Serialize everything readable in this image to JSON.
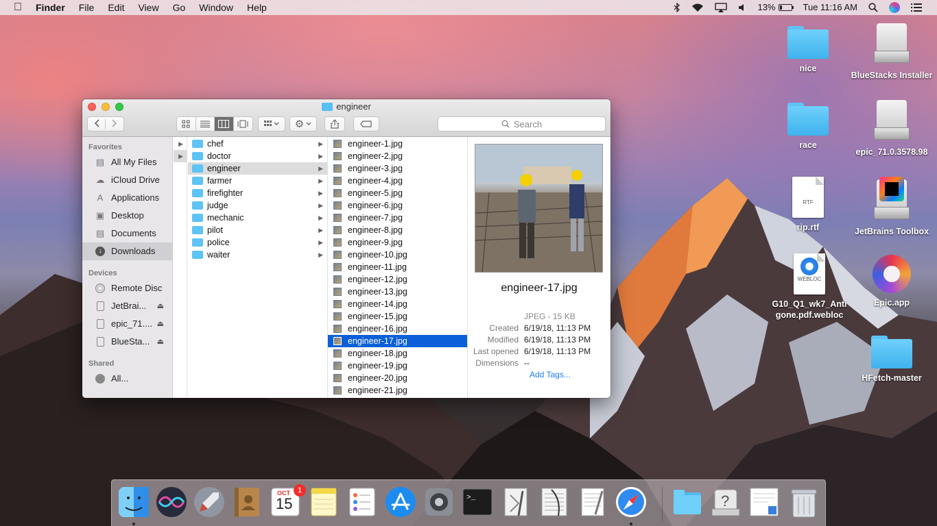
{
  "menubar": {
    "apple": "",
    "app_name": "Finder",
    "menus": [
      "File",
      "Edit",
      "View",
      "Go",
      "Window",
      "Help"
    ],
    "battery": "13%",
    "clock": "Tue 11:16 AM"
  },
  "desktop": {
    "icons": [
      {
        "label": "nice",
        "kind": "folder"
      },
      {
        "label": "BlueStacks Installer",
        "kind": "drive"
      },
      {
        "label": "race",
        "kind": "folder"
      },
      {
        "label": "epic_71.0.3578.98",
        "kind": "drive"
      },
      {
        "label": "rip.rtf",
        "kind": "document",
        "doc_label": "RTF"
      },
      {
        "label": "JetBrains Toolbox",
        "kind": "drive"
      },
      {
        "label": "G10_Q1_wk7_Antigone.pdf.webloc",
        "kind": "document",
        "doc_label": "WEBLOC"
      },
      {
        "label": "Epic.app",
        "kind": "app"
      },
      {
        "label": "HFetch-master",
        "kind": "folder"
      }
    ]
  },
  "finder": {
    "title": "engineer",
    "search_placeholder": "Search",
    "sidebar": {
      "favorites_header": "Favorites",
      "favorites": [
        {
          "label": "All My Files",
          "icon": "all-files-icon"
        },
        {
          "label": "iCloud Drive",
          "icon": "cloud-icon"
        },
        {
          "label": "Applications",
          "icon": "applications-icon"
        },
        {
          "label": "Desktop",
          "icon": "desktop-icon"
        },
        {
          "label": "Documents",
          "icon": "documents-icon"
        },
        {
          "label": "Downloads",
          "icon": "downloads-icon",
          "selected": true
        }
      ],
      "devices_header": "Devices",
      "devices": [
        {
          "label": "Remote Disc",
          "eject": false
        },
        {
          "label": "JetBrai...",
          "eject": true
        },
        {
          "label": "epic_71....",
          "eject": true
        },
        {
          "label": "BlueSta...",
          "eject": true
        }
      ],
      "shared_header": "Shared",
      "shared": [
        {
          "label": "All..."
        }
      ]
    },
    "folders": [
      "chef",
      "doctor",
      "engineer",
      "farmer",
      "firefighter",
      "judge",
      "mechanic",
      "pilot",
      "police",
      "waiter"
    ],
    "selected_folder": "engineer",
    "files": [
      "engineer-1.jpg",
      "engineer-2.jpg",
      "engineer-3.jpg",
      "engineer-4.jpg",
      "engineer-5.jpg",
      "engineer-6.jpg",
      "engineer-7.jpg",
      "engineer-8.jpg",
      "engineer-9.jpg",
      "engineer-10.jpg",
      "engineer-11.jpg",
      "engineer-12.jpg",
      "engineer-13.jpg",
      "engineer-14.jpg",
      "engineer-15.jpg",
      "engineer-16.jpg",
      "engineer-17.jpg",
      "engineer-18.jpg",
      "engineer-19.jpg",
      "engineer-20.jpg",
      "engineer-21.jpg"
    ],
    "selected_file": "engineer-17.jpg",
    "preview": {
      "name": "engineer-17.jpg",
      "kind_size": "JPEG - 15 KB",
      "created_label": "Created",
      "created": "6/19/18, 11:13 PM",
      "modified_label": "Modified",
      "modified": "6/19/18, 11:13 PM",
      "last_opened_label": "Last opened",
      "last_opened": "6/19/18, 11:13 PM",
      "dimensions_label": "Dimensions",
      "dimensions": "--",
      "add_tags": "Add Tags..."
    }
  },
  "dock": {
    "apps": [
      "Finder",
      "Siri",
      "Launchpad",
      "Contacts",
      "Calendar",
      "Notes",
      "Reminders",
      "App Store",
      "System Preferences",
      "Terminal",
      "Script Editor",
      "Activity Monitor",
      "TextEdit",
      "Safari",
      "Downloads",
      "Help Viewer",
      "Preview Document",
      "Trash"
    ],
    "calendar_month": "OCT",
    "calendar_day": "15",
    "calendar_badge": "1"
  }
}
